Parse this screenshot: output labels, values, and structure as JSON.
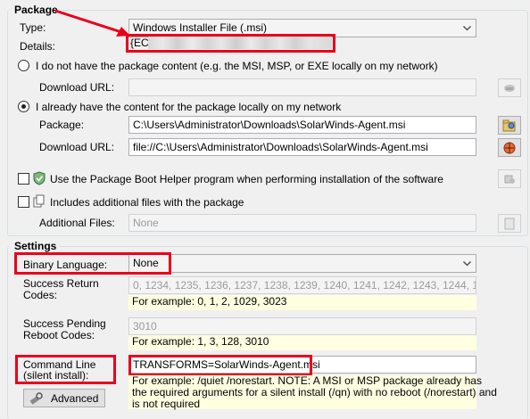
{
  "package": {
    "group_title": "Package",
    "type_label": "Type:",
    "type_value": "Windows Installer File (.msi)",
    "details_label": "Details:",
    "details_value": "{EC",
    "radio_no_content": "I do not have the package content (e.g. the MSI, MSP, or EXE locally on my network)",
    "download_url_label_1": "Download URL:",
    "download_url_value_1": "",
    "radio_have_content": "I already have the content for the package locally on my network",
    "package_label": "Package:",
    "package_value": "C:\\Users\\Administrator\\Downloads\\SolarWinds-Agent.msi",
    "download_url_label_2": "Download URL:",
    "download_url_value_2": "file://C:\\Users\\Administrator\\Downloads\\SolarWinds-Agent.msi",
    "boot_helper_label": "Use the Package Boot Helper program when performing installation of the software",
    "additional_files_check_label": "Includes additional files with the package",
    "additional_files_label": "Additional Files:",
    "additional_files_value": "None"
  },
  "settings": {
    "group_title": "Settings",
    "binary_language_label": "Binary Language:",
    "binary_language_value": "None",
    "success_return_label_1": "Success Return",
    "success_return_label_2": "Codes:",
    "success_return_value": "0, 1234, 1235, 1236, 1237, 1238, 1239, 1240, 1241, 1242, 1243, 1244, 124",
    "success_return_hint": "For example: 0, 1, 2, 1029, 3023",
    "success_pending_label_1": "Success Pending",
    "success_pending_label_2": "Reboot Codes:",
    "success_pending_value": "3010",
    "success_pending_hint": "For example: 1, 3, 128, 3010",
    "command_line_label_1": "Command Line",
    "command_line_label_2": "(silent install):",
    "command_line_value": "TRANSFORMS=SolarWinds-Agent.msi",
    "command_line_hint_1": "For example: /quiet /norestart. NOTE: A MSI or MSP package already has",
    "command_line_hint_2": "the required arguments for a silent install (/qn) with no reboot (/norestart) and",
    "command_line_hint_3": "is not required",
    "advanced_button": "Advanced"
  },
  "colors": {
    "annotation_red": "#e8001c",
    "hint_background": "#ffffe1",
    "group_border": "#d5dfe5"
  }
}
